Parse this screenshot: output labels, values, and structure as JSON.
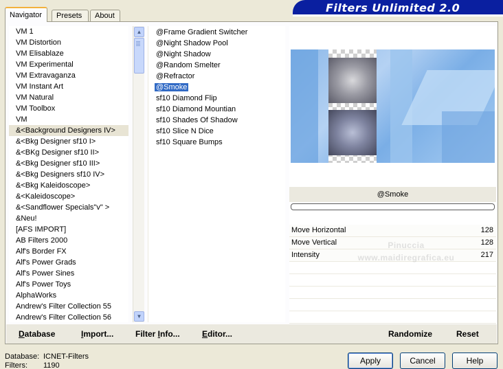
{
  "tabs": [
    {
      "label": "Navigator",
      "active": true
    },
    {
      "label": "Presets",
      "active": false
    },
    {
      "label": "About",
      "active": false
    }
  ],
  "banner": {
    "title": "Filters Unlimited 2.0"
  },
  "categories": [
    "VM 1",
    "VM Distortion",
    "VM Elisablaze",
    "VM Experimental",
    "VM Extravaganza",
    "VM Instant Art",
    "VM Natural",
    "VM Toolbox",
    "VM",
    "&<Background Designers IV>",
    "&<Bkg Designer sf10 I>",
    "&<BKg Designer sf10 II>",
    "&<Bkg Designer sf10 III>",
    "&<Bkg Designers sf10 IV>",
    "&<Bkg Kaleidoscope>",
    "&<Kaleidoscope>",
    "&<Sandflower Specials\"v\" >",
    "&Neu!",
    "[AFS IMPORT]",
    "AB Filters 2000",
    "Alf's Border FX",
    "Alf's Power Grads",
    "Alf's Power Sines",
    "Alf's Power Toys",
    "AlphaWorks",
    "Andrew's Filter Collection 55",
    "Andrew's Filter Collection 56"
  ],
  "selected_category_index": 9,
  "filters": [
    "@Frame Gradient Switcher",
    "@Night Shadow Pool",
    "@Night Shadow",
    "@Random Smelter",
    "@Refractor",
    "@Smoke",
    "sf10 Diamond Flip",
    "sf10 Diamond Mountian",
    "sf10 Shades Of Shadow",
    "sf10 Slice N Dice",
    "sf10 Square Bumps"
  ],
  "selected_filter_index": 5,
  "selected_filter_name": "@Smoke",
  "progress": 0,
  "params": [
    {
      "label": "Move Horizontal",
      "value": "128"
    },
    {
      "label": "Move Vertical",
      "value": "128"
    },
    {
      "label": "Intensity",
      "value": "217"
    }
  ],
  "watermark": {
    "line1": "Pinuccia",
    "line2": "www.maidiregrafica.eu"
  },
  "toolbar": {
    "database": {
      "u": "D",
      "rest": "atabase"
    },
    "import": {
      "u": "I",
      "rest": "mport..."
    },
    "filterinfo": {
      "pre": "Filter ",
      "u": "I",
      "rest": "nfo..."
    },
    "editor": {
      "u": "E",
      "rest": "ditor..."
    },
    "randomize": "Randomize",
    "reset": "Reset"
  },
  "status": {
    "database_label": "Database:",
    "database_value": "ICNET-Filters",
    "filters_label": "Filters:",
    "filters_value": "1190"
  },
  "buttons": {
    "apply": "Apply",
    "cancel": "Cancel",
    "help": "Help"
  },
  "colors": {
    "selection": "#316ac5",
    "banner": "#0a1fa0",
    "accent_tab": "#f2b13c"
  },
  "icons": {
    "scroll_up": "scroll-up-icon",
    "scroll_down": "scroll-down-icon"
  }
}
